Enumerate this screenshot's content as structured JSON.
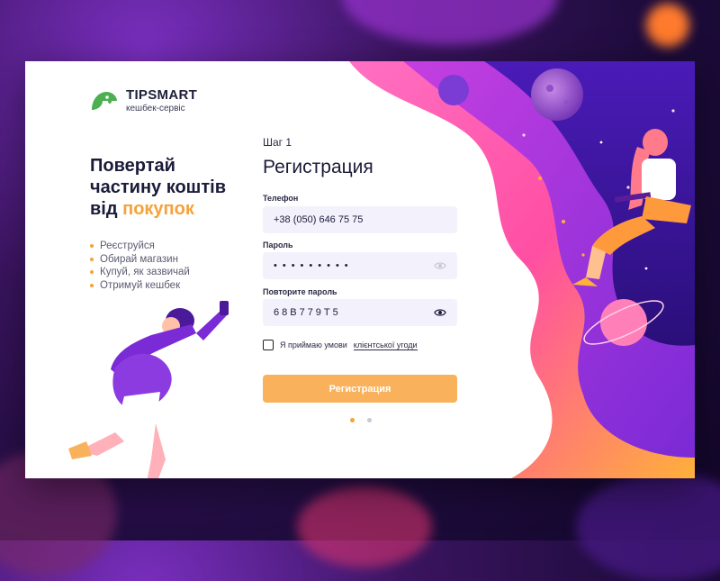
{
  "brand": {
    "name": "TIPSMART",
    "tagline": "кешбек-сервіс",
    "accent": "#f5a23a",
    "logo_color": "#4caf50"
  },
  "hero": {
    "line1": "Повертай",
    "line2": "частину коштів",
    "line3_prefix": "від",
    "line3_accent": "покупок"
  },
  "steps": [
    "Реєструйся",
    "Обирай магазин",
    "Купуй, як зазвичай",
    "Отримуй кешбек"
  ],
  "form": {
    "step_label": "Шаг 1",
    "title": "Регистрация",
    "phone": {
      "label": "Телефон",
      "value": "+38 (050) 646 75 75"
    },
    "password": {
      "label": "Пароль",
      "value": "•••••••••",
      "icon": "eye-icon"
    },
    "confirm": {
      "label": "Повторите пароль",
      "value": "68B779T5",
      "icon": "eye-icon"
    },
    "agree_text": "Я приймаю умови",
    "agree_link": "клієнтської угоди",
    "submit_label": "Регистрация",
    "pager": {
      "pages": 2,
      "current": 1
    }
  },
  "colors": {
    "button": "#f9b25b",
    "field_bg": "#f3f1fb",
    "illustration_purple": "#6a22c9",
    "illustration_pink": "#ff4fa3"
  }
}
